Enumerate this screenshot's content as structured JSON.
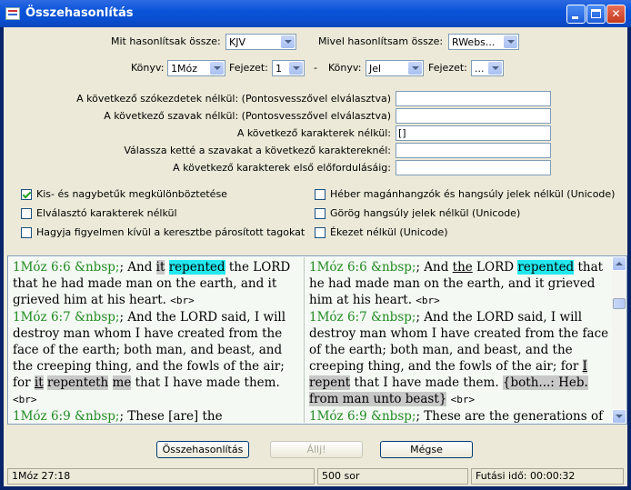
{
  "window": {
    "title": "Összehasonlítás"
  },
  "compare": {
    "what_label": "Mit hasonlítsak össze:",
    "what_value": "KJV",
    "with_label": "Mivel hasonlítsam össze:",
    "with_value": "RWebs..."
  },
  "range": {
    "book_label": "Könyv:",
    "book_from": "1Móz",
    "chapter_label": "Fejezet:",
    "chapter_from": "1",
    "dash": "-",
    "book_to": "Jel",
    "chapter_to": "..."
  },
  "filters": [
    {
      "label": "A következő szókezdetek nélkül: (Pontosvesszővel elválasztva)",
      "value": ""
    },
    {
      "label": "A következő szavak nélkül: (Pontosvesszővel elválasztva)",
      "value": ""
    },
    {
      "label": "A következő karakterek nélkül:",
      "value": "[]"
    },
    {
      "label": "Válassza ketté a szavakat a következő karaktereknél:",
      "value": ""
    },
    {
      "label": "A következő karakterek első előfordulásáig:",
      "value": ""
    }
  ],
  "options": [
    {
      "label": "Kis- és nagybetűk megkülönböztetése",
      "checked": true
    },
    {
      "label": "Elválasztó karakterek nélkül",
      "checked": false
    },
    {
      "label": "Hagyja figyelmen kívül a keresztbe párosított tagokat",
      "checked": false
    },
    {
      "label": "Héber magánhangzók és hangsúly jelek nélkül (Unicode)",
      "checked": false
    },
    {
      "label": "Görög hangsúly jelek nélkül (Unicode)",
      "checked": false
    },
    {
      "label": "Ékezet nélkül (Unicode)",
      "checked": false
    }
  ],
  "left_text": {
    "v1_ref": "1Móz 6:6 &nbsp;",
    "v1_a": "; And ",
    "v1_it": "it",
    "v1_sp": " ",
    "v1_rep": "repented",
    "v1_b": " the LORD that he had made man on the earth, and it grieved him at his heart. ",
    "br": "<br>",
    "v2_ref": "1Móz 6:7 &nbsp;",
    "v2_a": "; And the LORD said, I will destroy man whom I have created from the face of the earth; both man, and beast, and the creeping thing, and the fowls of the air; for ",
    "v2_it": "it",
    "v2_sp": " ",
    "v2_repenteth": "repenteth",
    "v2_sp2": " ",
    "v2_me": "me",
    "v2_b": " that I have made them. ",
    "v3_ref": "1Móz 6:9 &nbsp;",
    "v3_a": "; These [are] the generations"
  },
  "right_text": {
    "v1_ref": "1Móz 6:6 &nbsp;",
    "v1_a": "; And ",
    "v1_the": "the",
    "v1_b": " LORD ",
    "v1_rep": "repented",
    "v1_c": " that he had made man on the earth, and it grieved him at his heart. ",
    "br": "<br>",
    "v2_ref": "1Móz 6:7 &nbsp;",
    "v2_a": "; And the LORD said, I will destroy man whom I have created from the face of the earth; both man, and beast, and the creeping thing, and the fowls of the air; for ",
    "v2_I": "I",
    "v2_sp": " ",
    "v2_repent": "repent",
    "v2_b": " that I have made them. ",
    "v2_note": "{both...: Heb. from man unto beast}",
    "v3_ref": "1Móz 6:9 &nbsp;",
    "v3_a": "; These are the generations of"
  },
  "buttons": {
    "compare": "Összehasonlítás",
    "stop": "Állj!",
    "cancel": "Mégse"
  },
  "status": {
    "position": "1Móz 27:18",
    "rows": "500  sor",
    "runtime": "Futási idő: 00:00:32"
  }
}
